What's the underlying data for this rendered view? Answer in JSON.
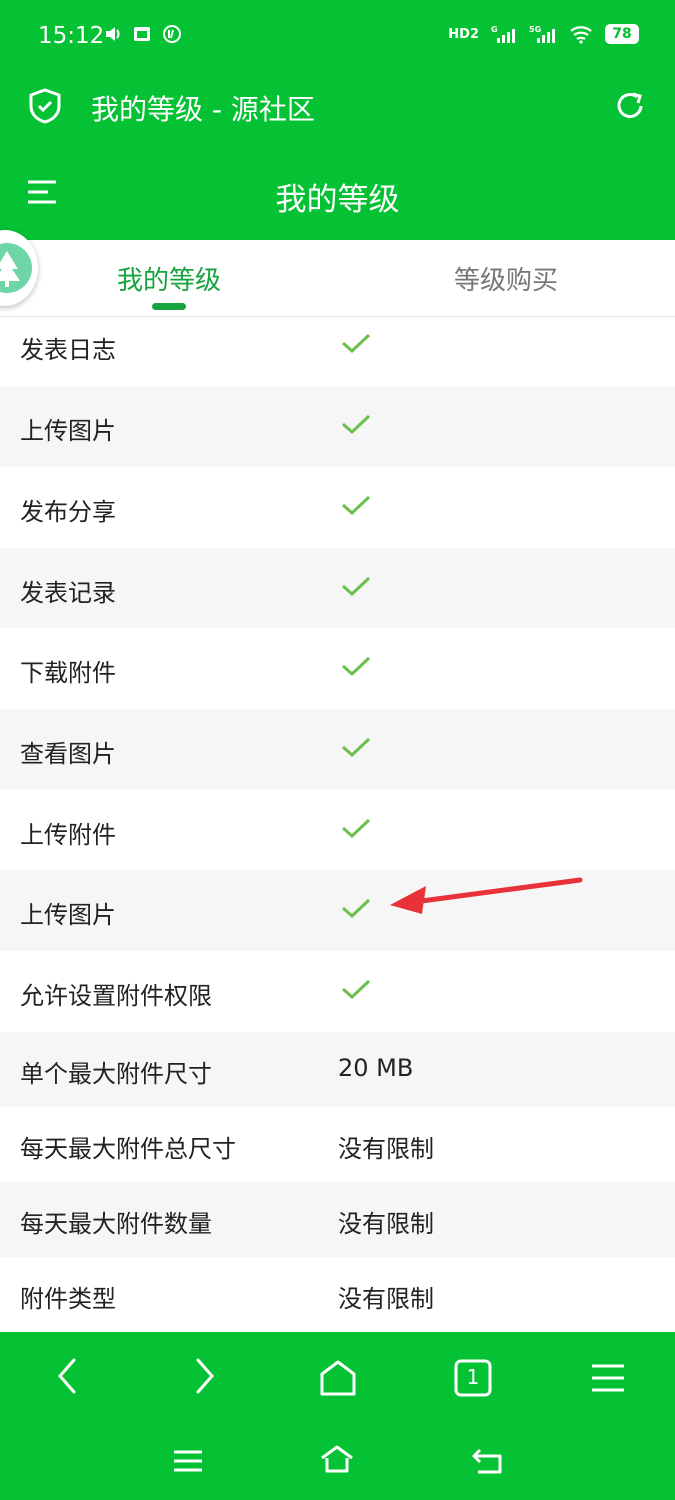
{
  "status_bar": {
    "time": "15:12",
    "battery": "78",
    "network_tags": [
      "HD2",
      "G",
      "5G"
    ]
  },
  "browser": {
    "title": "我的等级 - 源社区"
  },
  "page": {
    "heading": "我的等级"
  },
  "tabs": [
    {
      "label": "我的等级",
      "active": true
    },
    {
      "label": "等级购买",
      "active": false
    }
  ],
  "rows": [
    {
      "label": "发表日志",
      "value": null,
      "check": true
    },
    {
      "label": "上传图片",
      "value": null,
      "check": true
    },
    {
      "label": "发布分享",
      "value": null,
      "check": true
    },
    {
      "label": "发表记录",
      "value": null,
      "check": true
    },
    {
      "label": "下载附件",
      "value": null,
      "check": true
    },
    {
      "label": "查看图片",
      "value": null,
      "check": true
    },
    {
      "label": "上传附件",
      "value": null,
      "check": true
    },
    {
      "label": "上传图片",
      "value": null,
      "check": true
    },
    {
      "label": "允许设置附件权限",
      "value": null,
      "check": true
    },
    {
      "label": "单个最大附件尺寸",
      "value": "20 MB",
      "check": false
    },
    {
      "label": "每天最大附件总尺寸",
      "value": "没有限制",
      "check": false
    },
    {
      "label": "每天最大附件数量",
      "value": "没有限制",
      "check": false
    },
    {
      "label": "附件类型",
      "value": "没有限制",
      "check": false
    }
  ],
  "bottom_nav": {
    "tab_count": "1",
    "icons": [
      "back-icon",
      "forward-icon",
      "home-icon",
      "tabs-icon",
      "menu-icon"
    ]
  },
  "colors": {
    "brand_green": "#05c134",
    "tab_active": "#16a340",
    "check": "#6bc04b",
    "arrow": "#e8323a"
  }
}
